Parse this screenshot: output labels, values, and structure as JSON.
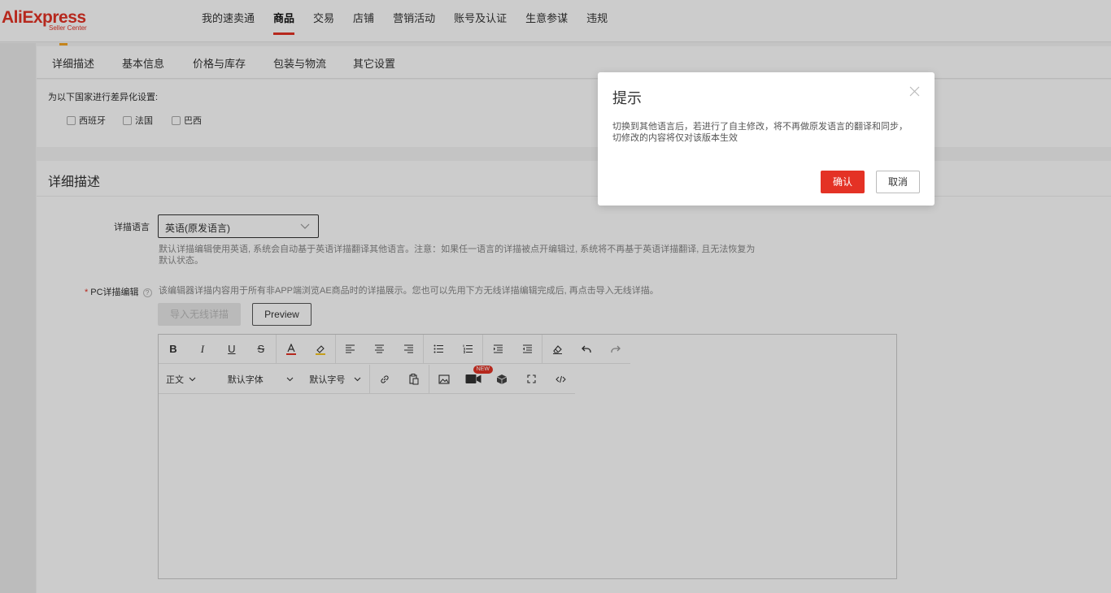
{
  "header": {
    "logo_brand": "AliExpress",
    "logo_sub": "Seller Center",
    "nav": [
      "我的速卖通",
      "商品",
      "交易",
      "店铺",
      "营销活动",
      "账号及认证",
      "生意参谋",
      "违规"
    ],
    "active_nav": "商品"
  },
  "section_tabs": [
    "详细描述",
    "基本信息",
    "价格与库存",
    "包装与物流",
    "其它设置"
  ],
  "countries": {
    "label": "为以下国家进行差异化设置:",
    "options": [
      "西班牙",
      "法国",
      "巴西"
    ]
  },
  "detail": {
    "title": "详细描述",
    "language_label": "详描语言",
    "language_value": "英语(原发语言)",
    "language_hint": "默认详描编辑使用英语, 系统会自动基于英语详描翻译其他语言。注意：如果任一语言的详描被点开编辑过, 系统将不再基于英语详描翻译, 且无法恢复为默认状态。",
    "pc_label": "PC详描编辑",
    "pc_hint": "该编辑器详描内容用于所有非APP端浏览AE商品时的详描展示。您也可以先用下方无线详描编辑完成后, 再点击导入无线详描。",
    "import_button": "导入无线详描",
    "preview_button": "Preview"
  },
  "editor": {
    "paragraph": "正文",
    "font_family": "默认字体",
    "font_size": "默认字号",
    "new_badge": "NEW"
  },
  "modal": {
    "title": "提示",
    "body": "切换到其他语言后，若进行了自主修改，将不再做原发语言的翻译和同步，切修改的内容将仅对该版本生效",
    "confirm": "确认",
    "cancel": "取消"
  },
  "colors": {
    "accent": "#e43225",
    "badge": "#f5a623"
  }
}
